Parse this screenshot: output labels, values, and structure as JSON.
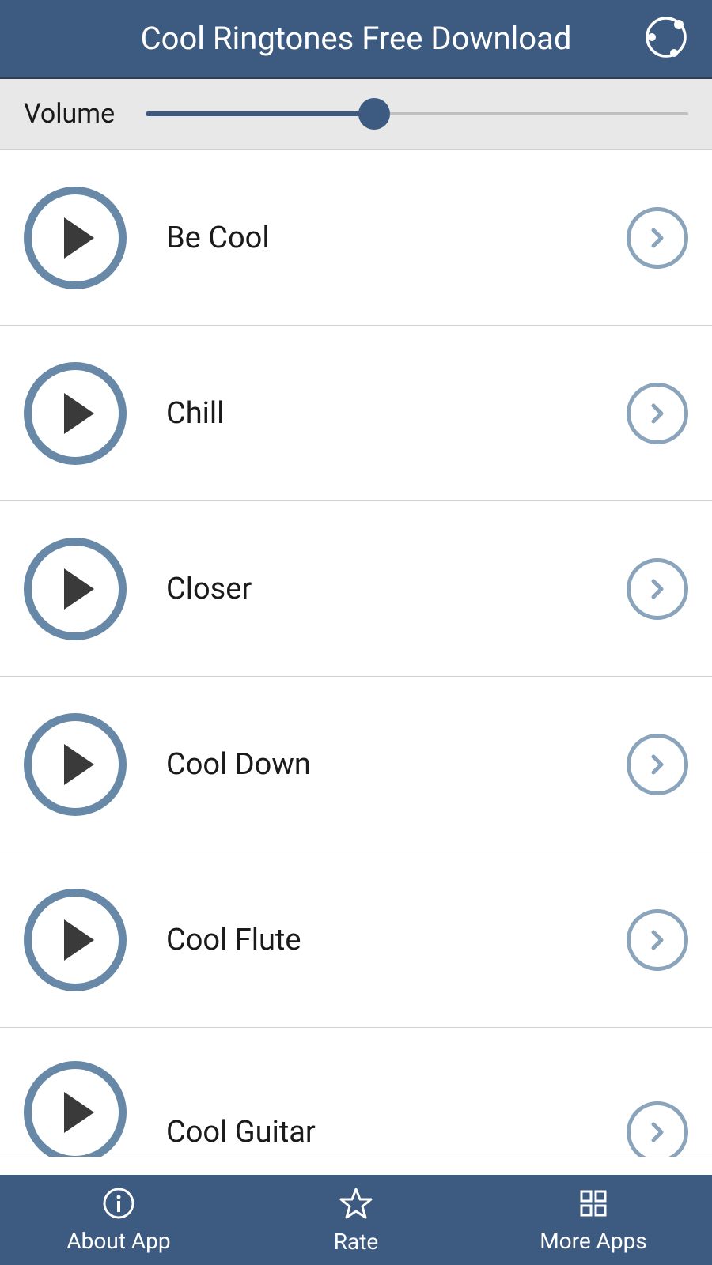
{
  "header": {
    "title": "Cool Ringtones Free Download"
  },
  "volume": {
    "label": "Volume",
    "percent": 42
  },
  "ringtones": [
    {
      "title": "Be Cool"
    },
    {
      "title": "Chill"
    },
    {
      "title": "Closer"
    },
    {
      "title": "Cool Down"
    },
    {
      "title": "Cool Flute"
    },
    {
      "title": "Cool Guitar"
    }
  ],
  "bottomNav": {
    "about": "About App",
    "rate": "Rate",
    "moreApps": "More Apps"
  }
}
